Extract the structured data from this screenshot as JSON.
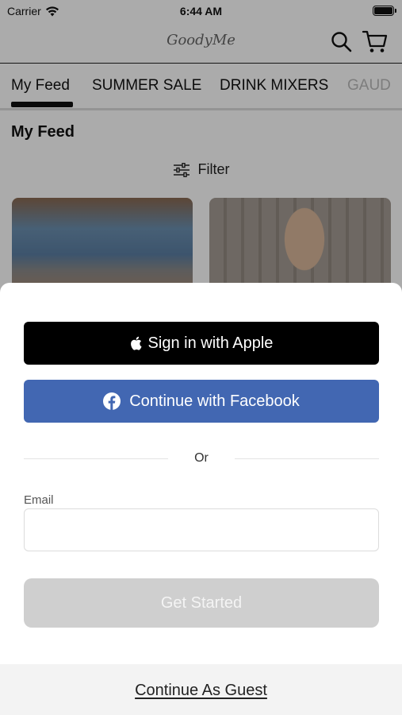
{
  "status_bar": {
    "carrier": "Carrier",
    "time": "6:44 AM"
  },
  "header": {
    "logo_text": "GoodyMe",
    "search_icon": "search-icon",
    "cart_icon": "cart-icon"
  },
  "tabs": [
    {
      "label": "My Feed",
      "selected": true
    },
    {
      "label": "SUMMER SALE",
      "selected": false
    },
    {
      "label": "DRINK MIXERS",
      "selected": false
    },
    {
      "label": "GAUD",
      "selected": false
    }
  ],
  "feed": {
    "title": "My Feed",
    "filter_label": "Filter"
  },
  "sheet": {
    "apple_button": "Sign in with Apple",
    "facebook_button": "Continue with Facebook",
    "divider_text": "Or",
    "email_label": "Email",
    "email_value": "",
    "get_started_button": "Get Started",
    "guest_link": "Continue As Guest"
  },
  "colors": {
    "apple_bg": "#000000",
    "facebook_bg": "#4267b2",
    "disabled_button_bg": "#cfcfcf",
    "overlay": "rgba(0,0,0,0.33)"
  }
}
